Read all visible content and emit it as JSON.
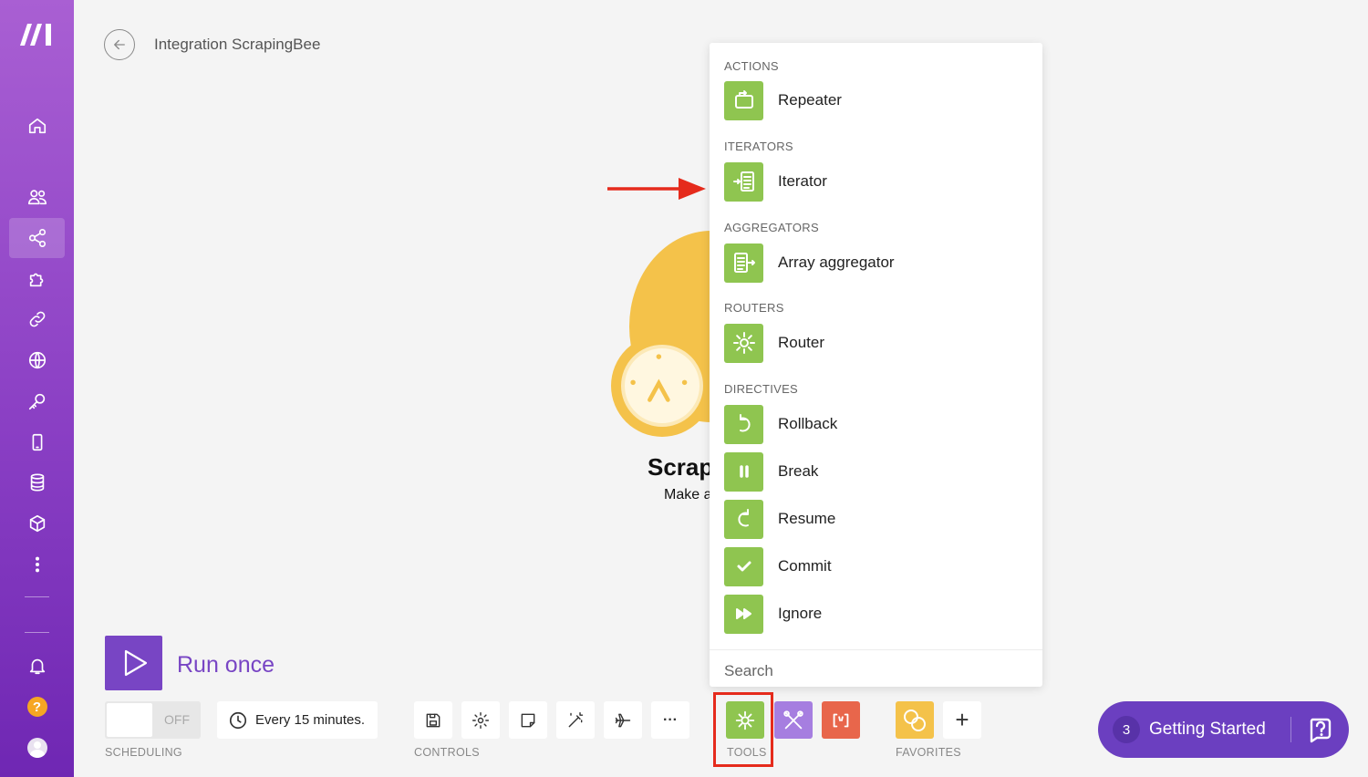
{
  "header": {
    "title": "Integration ScrapingBee"
  },
  "module": {
    "name": "Scrap",
    "subtitle": "Make a"
  },
  "dropdown": {
    "sections": [
      {
        "label": "ACTIONS",
        "items": [
          {
            "label": "Repeater",
            "icon": "repeat-icon"
          }
        ]
      },
      {
        "label": "ITERATORS",
        "items": [
          {
            "label": "Iterator",
            "icon": "iterator-icon"
          }
        ]
      },
      {
        "label": "AGGREGATORS",
        "items": [
          {
            "label": "Array aggregator",
            "icon": "aggregator-icon"
          }
        ]
      },
      {
        "label": "ROUTERS",
        "items": [
          {
            "label": "Router",
            "icon": "gear-icon"
          }
        ]
      },
      {
        "label": "DIRECTIVES",
        "items": [
          {
            "label": "Rollback",
            "icon": "undo-icon"
          },
          {
            "label": "Break",
            "icon": "pause-icon"
          },
          {
            "label": "Resume",
            "icon": "redo-icon"
          },
          {
            "label": "Commit",
            "icon": "check-icon"
          },
          {
            "label": "Ignore",
            "icon": "fast-forward-icon"
          }
        ]
      }
    ],
    "search_placeholder": "Search"
  },
  "run": {
    "label": "Run once"
  },
  "scheduling": {
    "toggle": "OFF",
    "interval": "Every 15 minutes.",
    "label": "SCHEDULING"
  },
  "controls": {
    "label": "CONTROLS",
    "more": "···"
  },
  "tools": {
    "label": "TOOLS"
  },
  "favorites": {
    "label": "FAVORITES",
    "add": "+"
  },
  "getting_started": {
    "count": "3",
    "label": "Getting Started"
  },
  "colors": {
    "brand_purple": "#7845c4",
    "tool_green": "#8fc550",
    "highlight_red": "#e52b1c",
    "module_yellow": "#f4c24a"
  }
}
